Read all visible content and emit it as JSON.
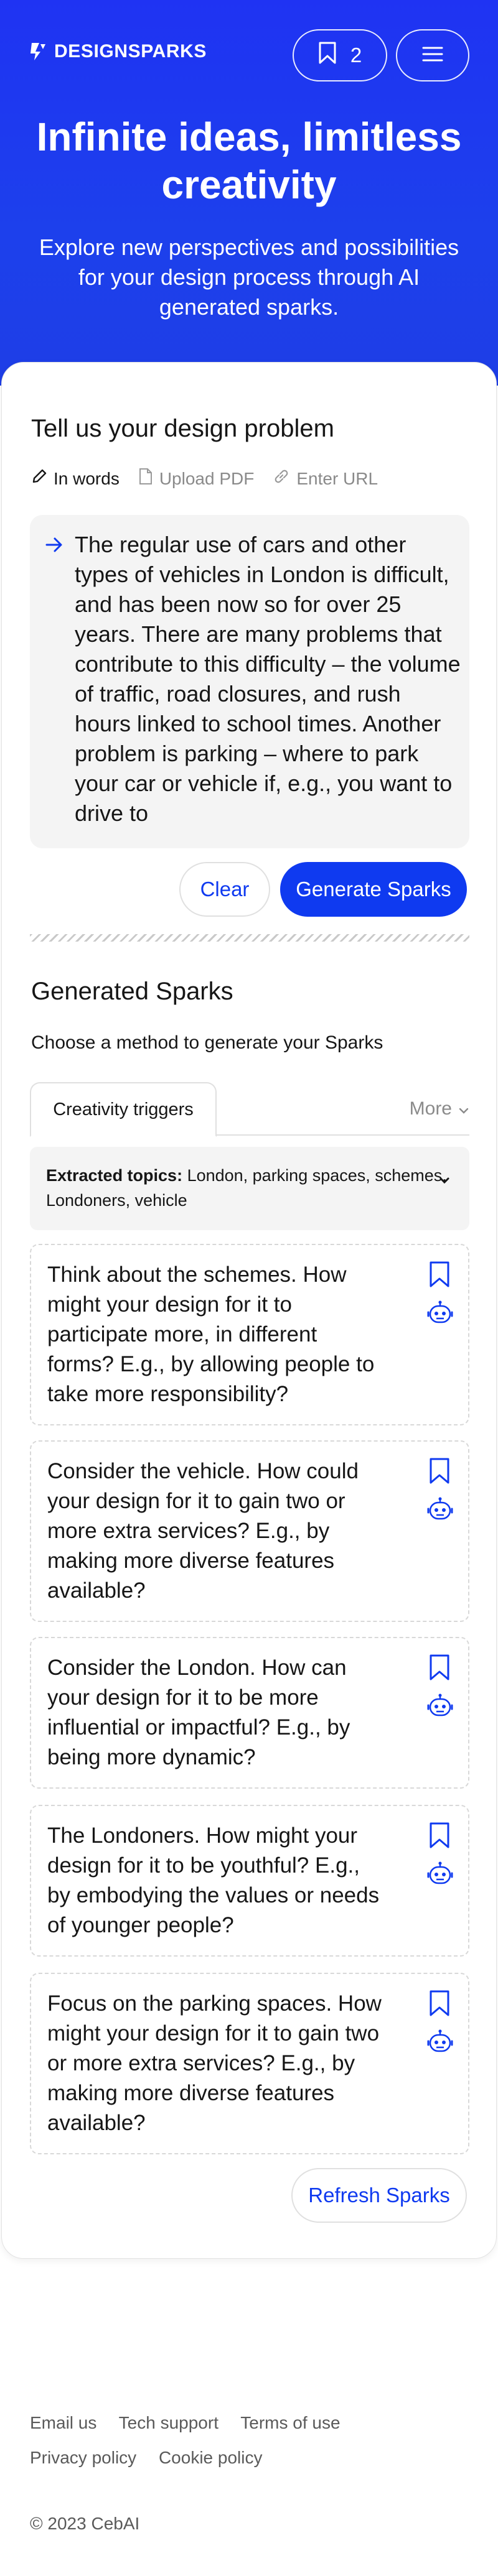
{
  "header": {
    "brand": "DESIGNSPARKS",
    "saved_count": "2",
    "bookmark_icon": "bookmark-icon",
    "menu_icon": "menu-icon"
  },
  "hero": {
    "title": "Infinite ideas, limitless creativity",
    "subtitle": "Explore new perspectives and possibilities for your design process through AI generated sparks."
  },
  "problem": {
    "heading": "Tell us your design problem",
    "modes": [
      {
        "label": "In words",
        "icon": "pencil-icon"
      },
      {
        "label": "Upload PDF",
        "icon": "document-icon"
      },
      {
        "label": "Enter URL",
        "icon": "link-icon"
      }
    ],
    "text": "The regular use of cars and other types of vehicles in London is difficult, and has been now so for over 25 years. There are many problems that contribute to this difficulty – the volume of traffic, road closures, and rush hours linked to school times. Another problem is parking – where to park your car or vehicle if, e.g., you want to drive to",
    "clear_label": "Clear",
    "generate_label": "Generate Sparks"
  },
  "generated": {
    "heading": "Generated Sparks",
    "method_prompt": "Choose a method to generate your Sparks",
    "tab_active": "Creativity triggers",
    "tab_more": "More",
    "topics_label": "Extracted topics:",
    "topics_value": " London, parking spaces, schemes, Londoners, vehicle",
    "sparks": [
      "Think about the schemes. How might your design for it to participate more, in different forms? E.g., by allowing people to take more responsibility?",
      "Consider the vehicle. How could your design for it to gain two or more extra services? E.g., by making more diverse features available?",
      "Consider the London. How can your design for it to be more influential or impactful? E.g., by being more dynamic?",
      "The Londoners. How might your design for it to be youthful? E.g., by embodying the values or needs of younger people?",
      "Focus on the parking spaces. How might your design for it to gain two or more extra services? E.g., by making more diverse features available?"
    ],
    "refresh_label": "Refresh Sparks"
  },
  "footer": {
    "links_row1": [
      "Email us",
      "Tech support",
      "Terms of use"
    ],
    "links_row2": [
      "Privacy policy",
      "Cookie policy"
    ],
    "copyright": "© 2023 CebAI"
  },
  "colors": {
    "brand_blue": "#0f3af0",
    "hero_blue": "#1f33f3"
  }
}
